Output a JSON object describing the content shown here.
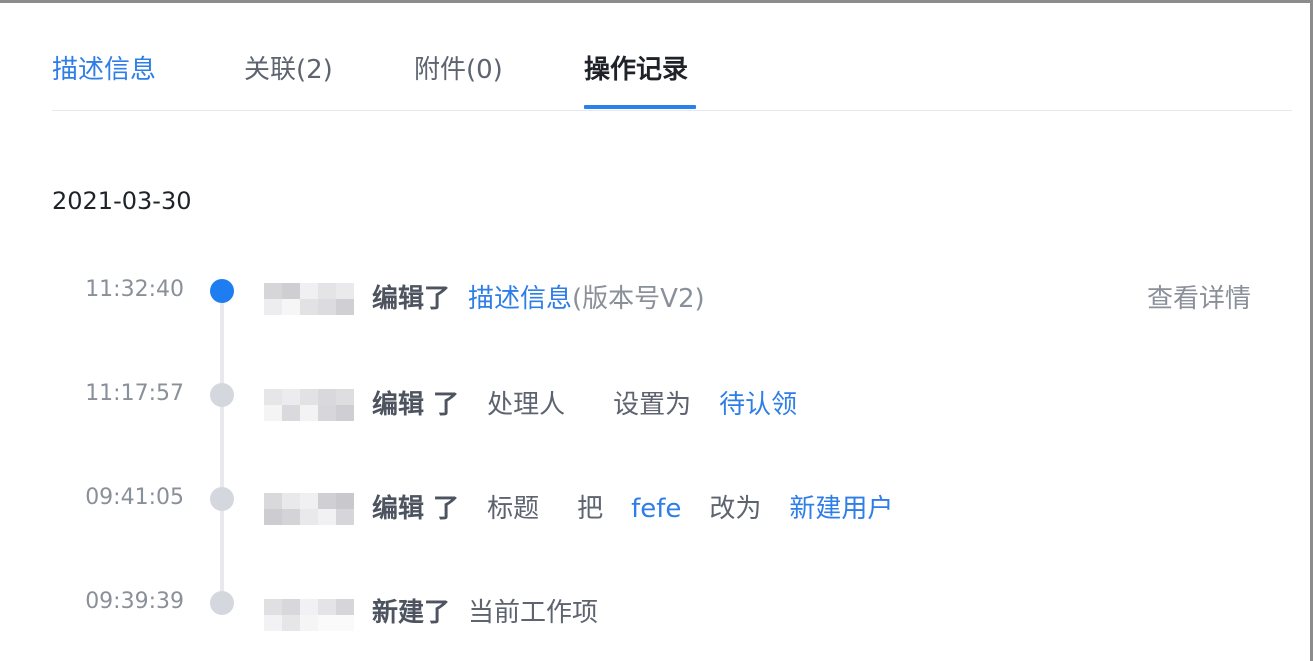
{
  "tabs": [
    {
      "label": "描述信息"
    },
    {
      "label": "关联(2)"
    },
    {
      "label": "附件(0)"
    },
    {
      "label": "操作记录"
    }
  ],
  "date": "2021-03-30",
  "records": [
    {
      "time": "11:32:40",
      "action": "编辑了",
      "link": "描述信息",
      "version": "(版本号V2)",
      "detail": "查看详情"
    },
    {
      "time": "11:17:57",
      "action": "编辑 了",
      "field": "处理人",
      "verb": "设置为",
      "value": "待认领"
    },
    {
      "time": "09:41:05",
      "action": "编辑 了",
      "field": "标题",
      "verb1": "把",
      "old_value": "fefe",
      "verb2": "改为",
      "new_value": "新建用户"
    },
    {
      "time": "09:39:39",
      "action": "新建了",
      "target": "当前工作项"
    }
  ],
  "colors": {
    "accent": "#2e7ee8",
    "active_dot": "#1e7df0",
    "inactive_dot": "#d4d7de"
  }
}
